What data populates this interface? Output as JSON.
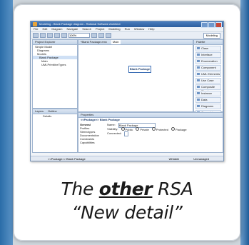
{
  "window": {
    "title": "Modeling - Blank Package diagram - Rational Software Architect",
    "perspective": "Modeling"
  },
  "menu": [
    "File",
    "Edit",
    "Diagram",
    "Navigate",
    "Search",
    "Project",
    "Modeling",
    "Run",
    "Window",
    "Help"
  ],
  "toolbar": {
    "zoom": "100%"
  },
  "project_explorer": {
    "tab": "Project Explorer",
    "items": [
      "Simple Model",
      "Diagrams",
      "Models",
      "Blank Package",
      "Main",
      "UMLPrimitiveTypes"
    ]
  },
  "editor": {
    "tabs": [
      "*Blank Package.emx",
      "Main"
    ],
    "node_label": "Blank Package"
  },
  "palette": {
    "title": "Palette",
    "items": [
      "Class",
      "Interface",
      "Enumeration",
      "Component",
      "UML Elements",
      "Use Case",
      "Composite Struct",
      "Instance",
      "Data",
      "Diagrams",
      "Geometric Shapes"
    ]
  },
  "outline": {
    "tabs": [
      "Layers",
      "Outline"
    ],
    "item": "Details"
  },
  "properties": {
    "tab": "Properties",
    "header": "<<Package>> Blank Package",
    "sidebar": [
      "General",
      "Profiles",
      "Stereotypes",
      "Documentation",
      "Constraints",
      "Capabilities"
    ],
    "name_label": "Name:",
    "name_value": "Blank Package",
    "visibility_label": "Visibility:",
    "visibility_options": [
      "Public",
      "Private",
      "Protected",
      "Package"
    ],
    "connected_label": "Connected:"
  },
  "status": {
    "left": "<<Package>> Blank Package",
    "mid": "Writable",
    "right": "Unmanaged"
  },
  "caption": {
    "line1_before": "The",
    "line1_emph": "other",
    "line1_after": "RSA",
    "line2": "“New detail”"
  }
}
